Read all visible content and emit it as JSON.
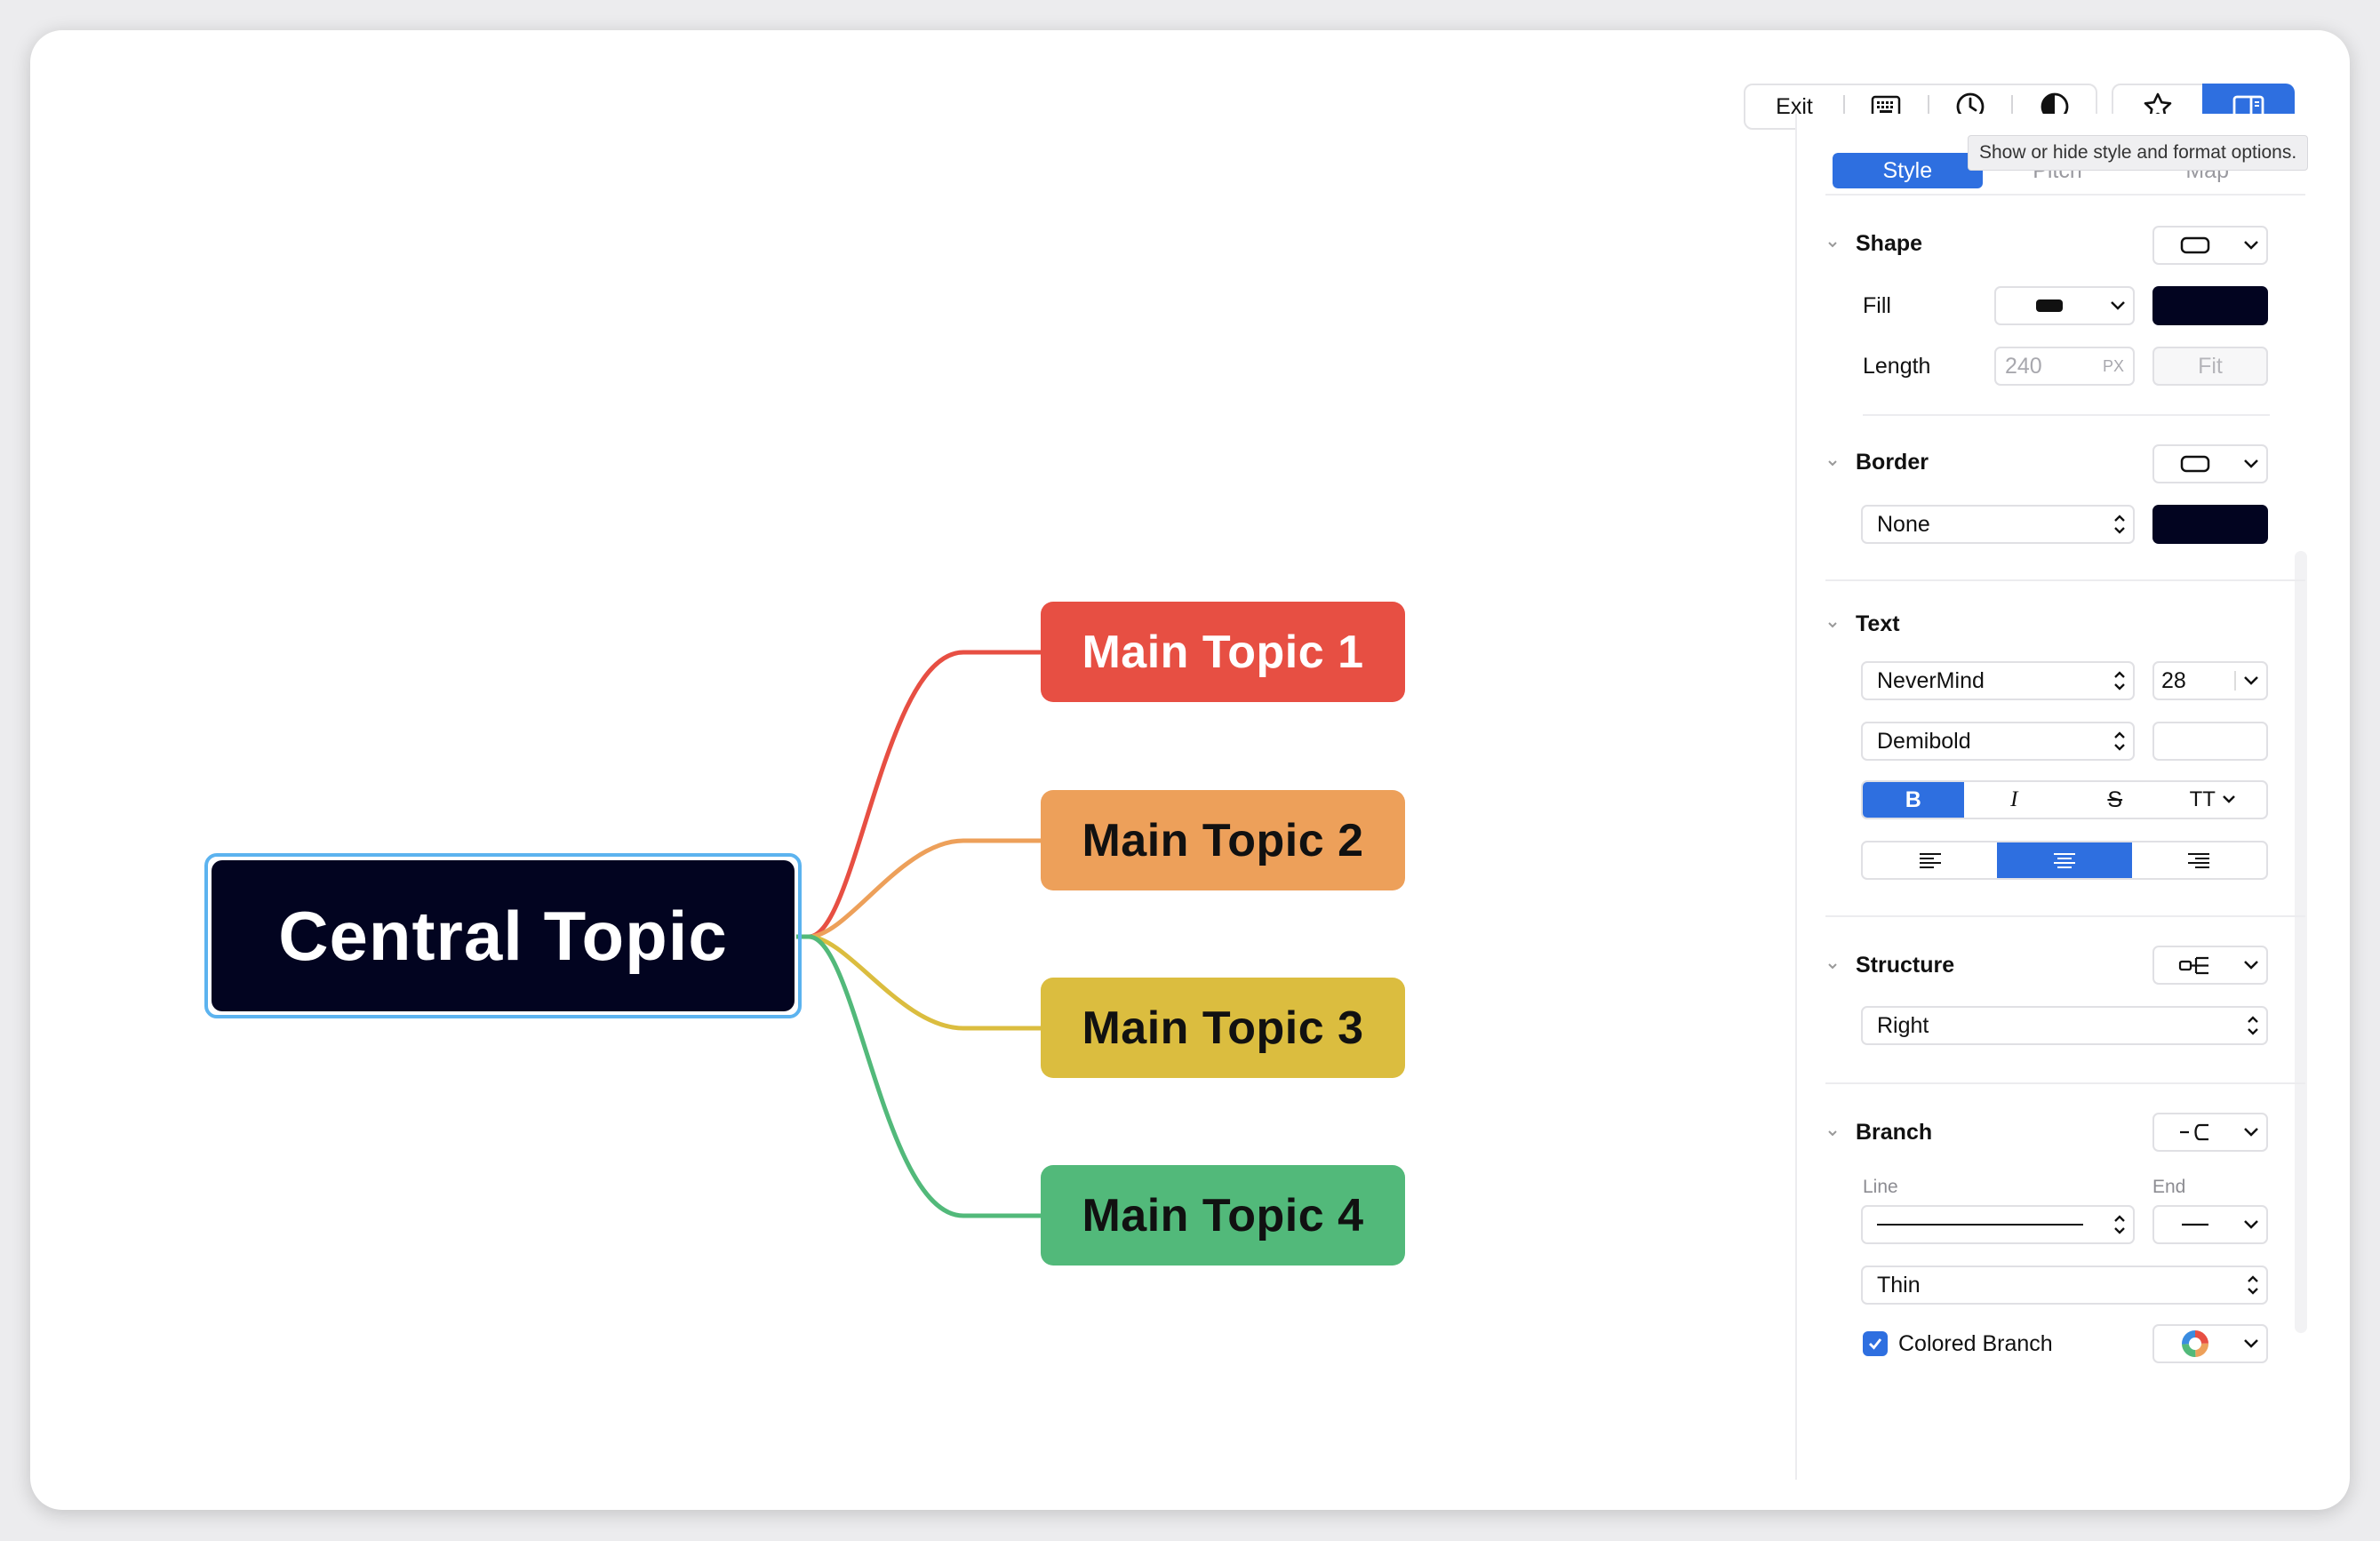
{
  "toolbar": {
    "exit_label": "Exit"
  },
  "tooltip": "Show or hide style and format options.",
  "tabs": [
    {
      "label": "Style",
      "active": true
    },
    {
      "label": "Pitch",
      "active": false
    },
    {
      "label": "Map",
      "active": false
    }
  ],
  "map": {
    "central": {
      "label": "Central Topic",
      "color": "#020420",
      "selected": true
    },
    "topics": [
      {
        "label": "Main Topic 1",
        "color": "#e74f43",
        "text_color": "#ffffff"
      },
      {
        "label": "Main Topic 2",
        "color": "#eda05a",
        "text_color": "#111111"
      },
      {
        "label": "Main Topic 3",
        "color": "#dbbd3f",
        "text_color": "#111111"
      },
      {
        "label": "Main Topic 4",
        "color": "#52b97a",
        "text_color": "#111111"
      }
    ]
  },
  "shape": {
    "title": "Shape",
    "fill_label": "Fill",
    "fill_color": "#020420",
    "length_label": "Length",
    "length_value": "240",
    "length_unit": "PX",
    "fit_label": "Fit"
  },
  "border": {
    "title": "Border",
    "style": "None",
    "color": "#020420"
  },
  "text": {
    "title": "Text",
    "font": "NeverMind",
    "size": "28",
    "weight": "Demibold",
    "bold_glyph": "B",
    "italic_glyph": "I",
    "strike_glyph": "S",
    "case_glyph": "TT"
  },
  "structure": {
    "title": "Structure",
    "value": "Right"
  },
  "branch": {
    "title": "Branch",
    "line_label": "Line",
    "end_label": "End",
    "thickness": "Thin",
    "colored_label": "Colored Branch",
    "colored_checked": true
  }
}
